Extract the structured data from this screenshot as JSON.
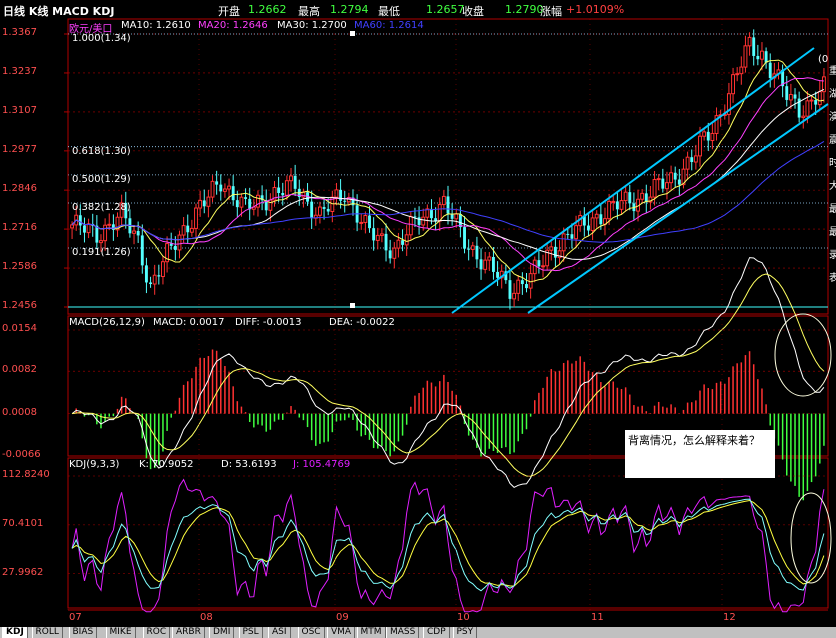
{
  "topbar": {
    "title": "日线 K线 MACD KDJ",
    "open_label": "开盘",
    "open_value": "1.2662",
    "high_label": "最高",
    "high_value": "1.2794",
    "low_label": "最低",
    "low_value": "1.2657",
    "close_label": "收盘",
    "close_value": "1.2790",
    "change_label": "涨幅",
    "change_value": "+1.0109%"
  },
  "main_legend": {
    "symbol": "欧元/美口",
    "ma10": "MA10: 1.2610",
    "ma20": "MA20: 1.2646",
    "ma30": "MA30: 1.2700",
    "ma60": "MA60: 1.2614"
  },
  "price_axis": [
    "1.3367",
    "1.3237",
    "1.3107",
    "1.2977",
    "1.2846",
    "1.2716",
    "1.2586",
    "1.2456"
  ],
  "fib_levels": [
    "1.000(1.34)",
    "0.618(1.30)",
    "0.500(1.29)",
    "0.382(1.28)",
    "0.191(1.26)"
  ],
  "fib_right_stub": "(0",
  "right_edge_chars": [
    "重",
    "湖",
    "演",
    "震",
    "时",
    "大",
    "最",
    "最",
    "录",
    "表"
  ],
  "macd_legend": {
    "name": "MACD(26,12,9)",
    "macd": "MACD: 0.0017",
    "diff": "DIFF: -0.0013",
    "dea": "DEA: -0.0022"
  },
  "macd_axis": [
    "0.0154",
    "0.0082",
    "0.0008",
    "-0.0066"
  ],
  "kdj_legend": {
    "name": "KDJ(9,3,3)",
    "k": "K: 70.9052",
    "d": "D: 53.6193",
    "j": "J: 105.4769"
  },
  "kdj_axis": [
    "112.8240",
    "70.4101",
    "27.9962"
  ],
  "month_labels": [
    "07",
    "08",
    "09",
    "10",
    "11",
    "12"
  ],
  "annotation_note": "背离情况，怎么解释来着？",
  "bottom_tabs": [
    "KDJ",
    "ROLL",
    "BIAS",
    "MIKE",
    "ROC",
    "ARBR",
    "DMI",
    "PSL",
    "ASI",
    "OSC",
    "VMA",
    "MTM",
    "MASS",
    "CDP",
    "PSY"
  ],
  "active_tab": "KDJ",
  "colors": {
    "up": "#ff3232",
    "down": "#54ffff",
    "ma10": "#ffff60",
    "ma20": "#ff40ff",
    "ma30": "#ffffff",
    "ma60": "#4040ff",
    "grid": "#b00000",
    "axis_text": "#ff5050",
    "trend": "#00c8ff",
    "kdj_j": "#e020ff",
    "kdj_d": "#ffff40",
    "kdj_k": "#80ffff"
  }
}
